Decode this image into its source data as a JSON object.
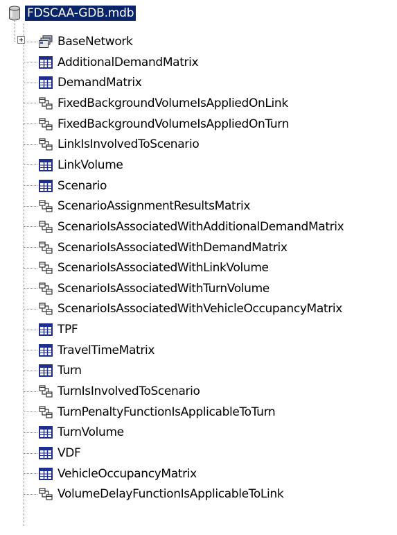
{
  "root": {
    "label": "FDSCAA-GDB.mdb",
    "icon": "database-icon"
  },
  "items": [
    {
      "label": "BaseNetwork",
      "icon": "feature-dataset-icon",
      "expandable": true
    },
    {
      "label": "AdditionalDemandMatrix",
      "icon": "table-icon"
    },
    {
      "label": "DemandMatrix",
      "icon": "table-icon"
    },
    {
      "label": "FixedBackgroundVolumeIsAppliedOnLink",
      "icon": "relationship-class-icon"
    },
    {
      "label": "FixedBackgroundVolumeIsAppliedOnTurn",
      "icon": "relationship-class-icon"
    },
    {
      "label": "LinkIsInvolvedToScenario",
      "icon": "relationship-class-icon"
    },
    {
      "label": "LinkVolume",
      "icon": "table-icon"
    },
    {
      "label": "Scenario",
      "icon": "table-icon"
    },
    {
      "label": "ScenarioAssignmentResultsMatrix",
      "icon": "relationship-class-icon"
    },
    {
      "label": "ScenarioIsAssociatedWithAdditionalDemandMatrix",
      "icon": "relationship-class-icon"
    },
    {
      "label": "ScenarioIsAssociatedWithDemandMatrix",
      "icon": "relationship-class-icon"
    },
    {
      "label": "ScenarioIsAssociatedWithLinkVolume",
      "icon": "relationship-class-icon"
    },
    {
      "label": "ScenarioIsAssociatedWithTurnVolume",
      "icon": "relationship-class-icon"
    },
    {
      "label": "ScenarioIsAssociatedWithVehicleOccupancyMatrix",
      "icon": "relationship-class-icon"
    },
    {
      "label": "TPF",
      "icon": "table-icon"
    },
    {
      "label": "TravelTimeMatrix",
      "icon": "table-icon"
    },
    {
      "label": "Turn",
      "icon": "table-icon"
    },
    {
      "label": "TurnIsInvolvedToScenario",
      "icon": "relationship-class-icon"
    },
    {
      "label": "TurnPenaltyFunctionIsApplicableToTurn",
      "icon": "relationship-class-icon"
    },
    {
      "label": "TurnVolume",
      "icon": "table-icon"
    },
    {
      "label": "VDF",
      "icon": "table-icon"
    },
    {
      "label": "VehicleOccupancyMatrix",
      "icon": "table-icon"
    },
    {
      "label": "VolumeDelayFunctionIsApplicableToLink",
      "icon": "relationship-class-icon"
    }
  ],
  "colors": {
    "selection": "#0a246a",
    "table_icon": "#1f2d8c",
    "connector": "#808080"
  }
}
